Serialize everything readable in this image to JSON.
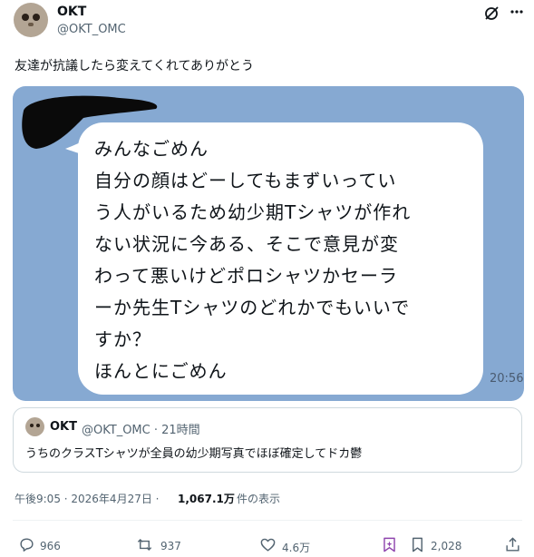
{
  "post": {
    "author_name": "OKT",
    "author_handle": "@OKT_OMC",
    "text": "友達が抗議したら変えてくれてありがとう"
  },
  "media": {
    "message_lines": [
      "みんなごめん",
      "自分の顔はどーしてもまずいってい",
      "う人がいるため幼少期Tシャツが作れ",
      "ない状況に今ある、そこで意見が変",
      "わって悪いけどポロシャツかセーラ",
      "ーか先生Tシャツのどれかでもいいで",
      "すか？",
      "ほんとにごめん"
    ],
    "time": "20:56"
  },
  "quote": {
    "author_name": "OKT",
    "author_handle": "@OKT_OMC · 21時間",
    "text": "うちのクラスTシャツが全員の幼少期写真でほぼ確定してドカ鬱"
  },
  "meta": {
    "date": "午後9:05 · 2026年4月27日 ·",
    "views": "1,067.1万",
    "views_label": "件の表示"
  },
  "actions": {
    "replies": "966",
    "reposts": "937",
    "likes": "4.6万",
    "bookmarks": "2,028"
  },
  "colors": {
    "media_bg": "#86a9d2",
    "text_primary": "#0f1419",
    "text_secondary": "#536471"
  }
}
